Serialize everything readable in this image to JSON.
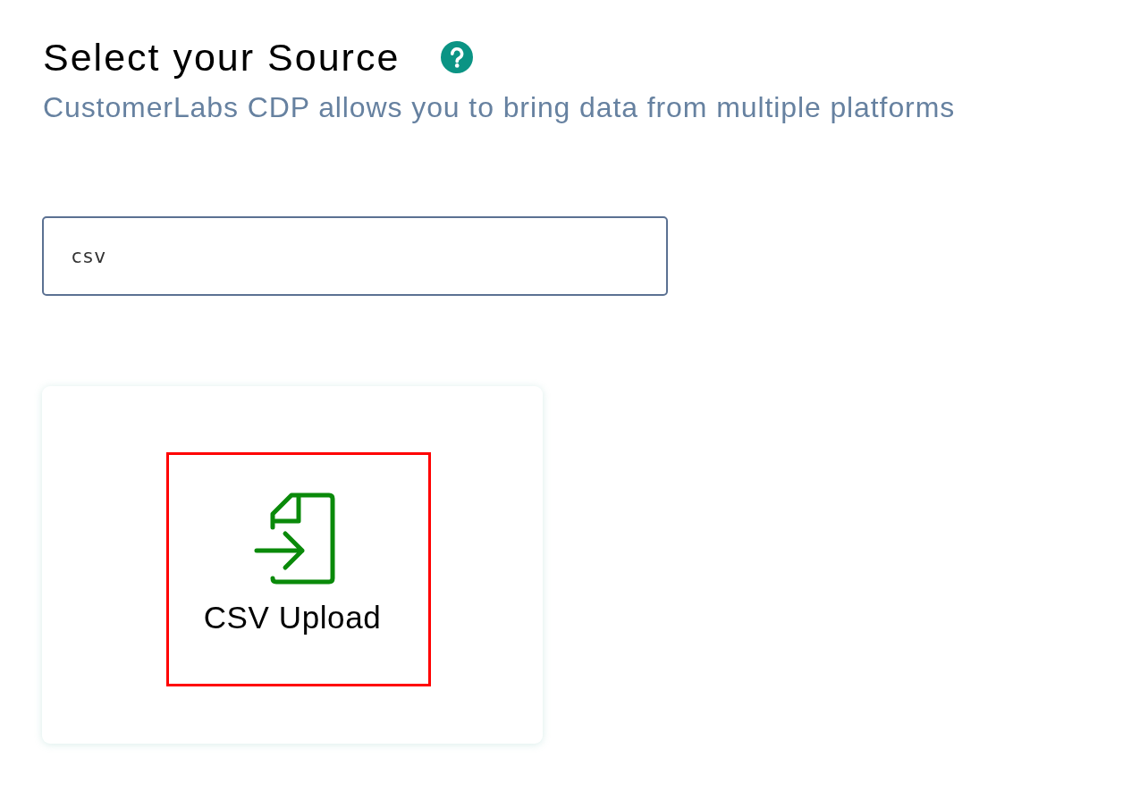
{
  "header": {
    "title": "Select your Source",
    "subtitle": "CustomerLabs CDP allows you to bring data from multiple platforms"
  },
  "search": {
    "value": "csv"
  },
  "sources": [
    {
      "label": "CSV Upload",
      "highlighted": true
    }
  ]
}
